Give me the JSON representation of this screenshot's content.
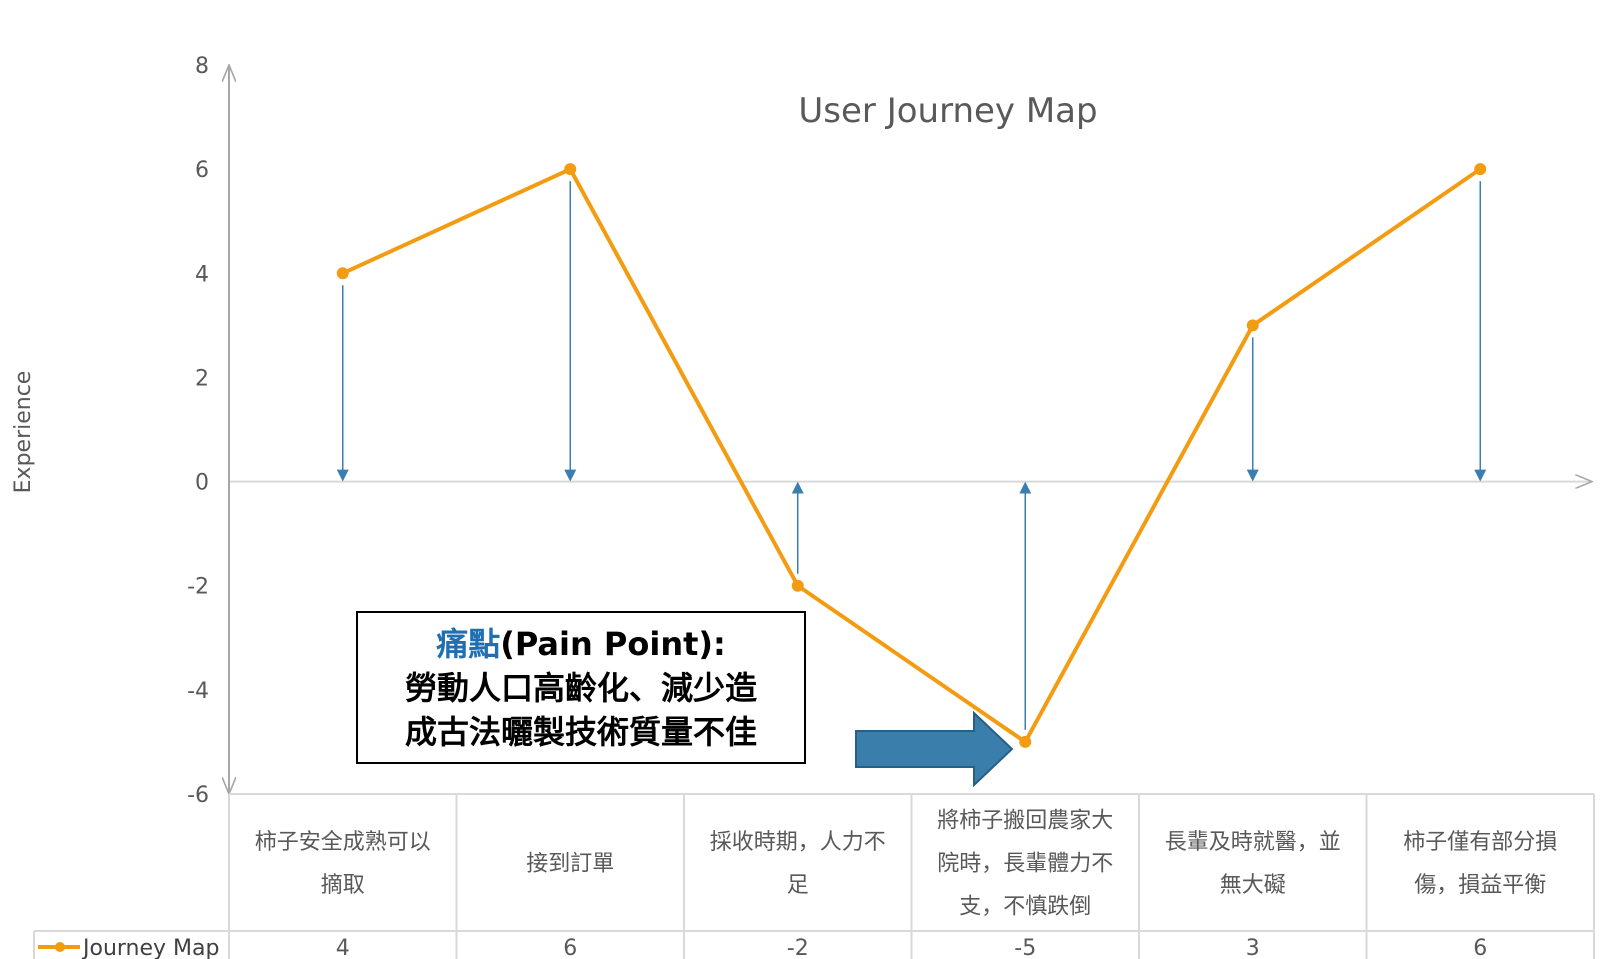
{
  "chart_data": {
    "type": "line",
    "title": "User Journey Map",
    "ylabel": "Experience",
    "xlabel": "",
    "ylim": [
      -6,
      8
    ],
    "yticks": [
      8,
      6,
      4,
      2,
      0,
      -2,
      -4,
      -6
    ],
    "categories": [
      [
        "柿子安全成熟可以",
        "摘取"
      ],
      [
        "接到訂單"
      ],
      [
        "採收時期，人力不",
        "足"
      ],
      [
        "將柿子搬回農家大",
        "院時，長輩體力不",
        "支，不慎跌倒"
      ],
      [
        "長輩及時就醫，並",
        "無大礙"
      ],
      [
        "柿子僅有部分損",
        "傷，損益平衡"
      ]
    ],
    "series": [
      {
        "name": "Journey Map",
        "values": [
          4,
          6,
          -2,
          -5,
          3,
          6
        ],
        "color": "#f39c12"
      }
    ],
    "drop_line_color": "#3b7fb0",
    "grid": false,
    "legend": "bottom-left, inside data table"
  },
  "annotation": {
    "accent_text": "痛點",
    "title_rest": "(Pain Point):",
    "lines": [
      "勞動人口高齡化、減少造",
      "成古法曬製技術質量不佳"
    ],
    "accent_color": "#1f6fb2",
    "arrow_color": "#3a7fab"
  }
}
